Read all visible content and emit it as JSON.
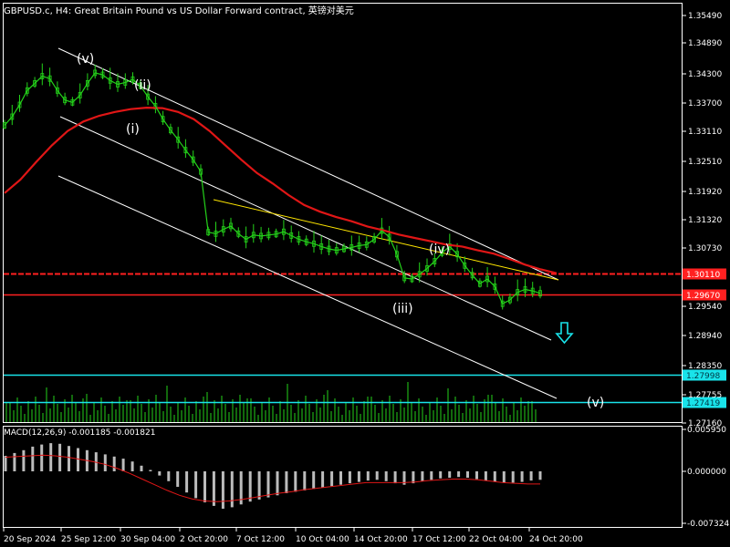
{
  "header": {
    "title": "GBPUSD.c, H4:  Great Britain Pound vs US Dollar Forward contract, 英镑对美元"
  },
  "macd": {
    "label": "MACD(12,26,9) -0.001185 -0.001821",
    "axis_ticks": [
      "0.005950",
      "0.000000",
      "-0.007324"
    ]
  },
  "chart_data": {
    "type": "line",
    "instrument": "GBPUSD.c",
    "timeframe": "H4",
    "price_axis_ticks": [
      "1.35490",
      "1.34890",
      "1.34300",
      "1.33700",
      "1.33110",
      "1.32510",
      "1.31920",
      "1.31320",
      "1.30730",
      "1.29540",
      "1.28940",
      "1.28350",
      "1.27755",
      "1.27160"
    ],
    "time_axis_ticks": [
      "20 Sep 2024",
      "25 Sep 12:00",
      "30 Sep 04:00",
      "2 Oct 20:00",
      "7 Oct 12:00",
      "10 Oct 04:00",
      "14 Oct 20:00",
      "17 Oct 12:00",
      "22 Oct 04:00",
      "24 Oct 20:00"
    ],
    "ylim": [
      1.27,
      1.3577
    ],
    "price_series": [
      1.3322,
      1.334,
      1.3365,
      1.3395,
      1.341,
      1.3425,
      1.342,
      1.3395,
      1.3375,
      1.337,
      1.3385,
      1.341,
      1.3432,
      1.3428,
      1.3416,
      1.3408,
      1.3412,
      1.3418,
      1.3405,
      1.3382,
      1.3362,
      1.3335,
      1.3312,
      1.3292,
      1.327,
      1.325,
      1.3225,
      1.3098,
      1.3095,
      1.3104,
      1.3111,
      1.3095,
      1.3083,
      1.3092,
      1.309,
      1.3092,
      1.3094,
      1.3099,
      1.3091,
      1.3083,
      1.3078,
      1.3074,
      1.3068,
      1.3063,
      1.306,
      1.3063,
      1.3066,
      1.307,
      1.3072,
      1.3083,
      1.3101,
      1.3088,
      1.3052,
      1.3002,
      1.3,
      1.301,
      1.3022,
      1.3037,
      1.3055,
      1.3068,
      1.3052,
      1.3028,
      1.3008,
      1.299,
      1.3,
      1.2984,
      1.2948,
      1.2956,
      1.2972,
      1.2978,
      1.2975,
      1.297
    ],
    "moving_average": [
      1.318,
      1.3208,
      1.3245,
      1.328,
      1.331,
      1.333,
      1.3342,
      1.335,
      1.3356,
      1.3359,
      1.3358,
      1.335,
      1.3335,
      1.331,
      1.328,
      1.325,
      1.3222,
      1.32,
      1.3176,
      1.3155,
      1.3141,
      1.313,
      1.3121,
      1.311,
      1.3102,
      1.3093,
      1.3086,
      1.3079,
      1.3072,
      1.3068,
      1.306,
      1.3053,
      1.3042,
      1.303,
      1.302,
      1.3012
    ],
    "horizontal_levels": [
      {
        "price": 1.3011,
        "label": "1.30110",
        "color": "#ff2020",
        "style": "dashed"
      },
      {
        "price": 1.2967,
        "label": "1.29670",
        "color": "#ff2020",
        "style": "solid"
      },
      {
        "price": 1.2799,
        "label": "1.27998",
        "color": "#19e3ea",
        "style": "solid"
      },
      {
        "price": 1.2742,
        "label": "1.27419",
        "color": "#19e3ea",
        "style": "solid"
      }
    ],
    "wave_labels": [
      "(v)",
      "(ii)",
      "(i)",
      "(iii)",
      "(iv)",
      "(v)"
    ],
    "colors": {
      "price": "#24d21a",
      "ma": "#e01616",
      "channel": "#ffffff",
      "trendline": "#ffe600",
      "support": "#19e3ea",
      "arrow": "#19e3ea",
      "volume": "#24d21a",
      "macd_hist": "#bcbcbc",
      "macd_signal": "#e01616"
    },
    "macd_series": [
      0.0022,
      0.0026,
      0.003,
      0.0035,
      0.0038,
      0.004,
      0.0039,
      0.0036,
      0.0033,
      0.003,
      0.0027,
      0.0024,
      0.0021,
      0.0018,
      0.0014,
      0.0008,
      0.0002,
      -0.0006,
      -0.0014,
      -0.0022,
      -0.003,
      -0.0038,
      -0.0044,
      -0.0049,
      -0.0053,
      -0.0051,
      -0.0047,
      -0.0043,
      -0.004,
      -0.0037,
      -0.0034,
      -0.0031,
      -0.0029,
      -0.0027,
      -0.0025,
      -0.0023,
      -0.0021,
      -0.0019,
      -0.0017,
      -0.0015,
      -0.0013,
      -0.0012,
      -0.0014,
      -0.0017,
      -0.0019,
      -0.0017,
      -0.0014,
      -0.0012,
      -0.001,
      -0.0009,
      -0.0008,
      -0.0009,
      -0.0011,
      -0.0013,
      -0.0015,
      -0.0016,
      -0.0016,
      -0.0015,
      -0.0013,
      -0.0012
    ],
    "macd_signal": [
      0.002,
      0.0021,
      0.0022,
      0.0023,
      0.0022,
      0.002,
      0.0017,
      0.0014,
      0.001,
      0.0004,
      -0.0003,
      -0.0011,
      -0.0019,
      -0.0027,
      -0.0034,
      -0.0039,
      -0.0042,
      -0.0043,
      -0.0042,
      -0.004,
      -0.0037,
      -0.0034,
      -0.0031,
      -0.0029,
      -0.0026,
      -0.0024,
      -0.0022,
      -0.002,
      -0.0018,
      -0.0016,
      -0.0016,
      -0.0016,
      -0.0016,
      -0.0015,
      -0.0013,
      -0.0012,
      -0.0011,
      -0.0011,
      -0.0012,
      -0.0014,
      -0.0016,
      -0.0017,
      -0.0018,
      -0.0018
    ]
  }
}
